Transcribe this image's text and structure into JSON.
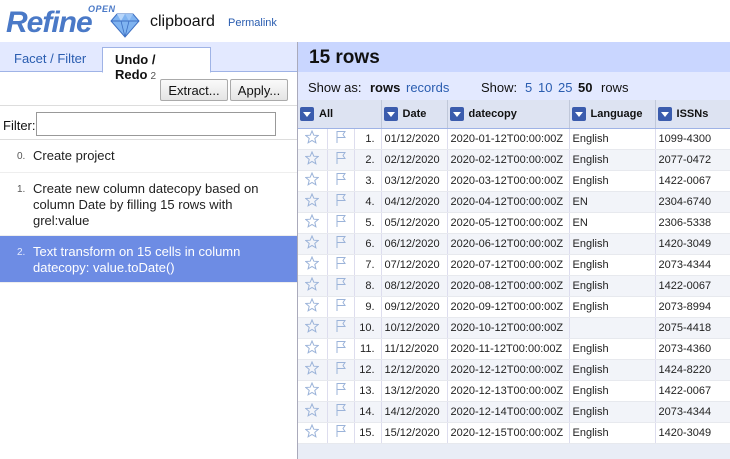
{
  "header": {
    "logo_open": "OPEN",
    "logo_refine": "Refine",
    "project_title": "clipboard",
    "permalink": "Permalink"
  },
  "left": {
    "tabs": [
      {
        "label": "Facet / Filter"
      },
      {
        "label": "Undo / Redo",
        "count": "2"
      }
    ],
    "extract_label": "Extract...",
    "apply_label": "Apply...",
    "filter_label": "Filter:",
    "filter_value": "",
    "history": [
      {
        "index": "0.",
        "text": "Create project"
      },
      {
        "index": "1.",
        "text": "Create new column datecopy based on column Date by filling 15 rows with grel:value"
      },
      {
        "index": "2.",
        "text": "Text transform on 15 cells in column datecopy: value.toDate()"
      }
    ]
  },
  "right": {
    "rows_title": "15 rows",
    "show_as_label": "Show as:",
    "rows_mode": "rows",
    "records_mode": "records",
    "show_label": "Show:",
    "page_sizes": [
      "5",
      "10",
      "25",
      "50"
    ],
    "rows_word": "rows",
    "columns": [
      "All",
      "Date",
      "datecopy",
      "Language",
      "ISSNs"
    ],
    "rows": [
      {
        "num": "1.",
        "date": "01/12/2020",
        "datecopy": "2020-01-12T00:00:00Z",
        "language": "English",
        "issns": "1099-4300"
      },
      {
        "num": "2.",
        "date": "02/12/2020",
        "datecopy": "2020-02-12T00:00:00Z",
        "language": "English",
        "issns": "2077-0472"
      },
      {
        "num": "3.",
        "date": "03/12/2020",
        "datecopy": "2020-03-12T00:00:00Z",
        "language": "English",
        "issns": "1422-0067"
      },
      {
        "num": "4.",
        "date": "04/12/2020",
        "datecopy": "2020-04-12T00:00:00Z",
        "language": "EN",
        "issns": "2304-6740"
      },
      {
        "num": "5.",
        "date": "05/12/2020",
        "datecopy": "2020-05-12T00:00:00Z",
        "language": "EN",
        "issns": "2306-5338"
      },
      {
        "num": "6.",
        "date": "06/12/2020",
        "datecopy": "2020-06-12T00:00:00Z",
        "language": "English",
        "issns": "1420-3049"
      },
      {
        "num": "7.",
        "date": "07/12/2020",
        "datecopy": "2020-07-12T00:00:00Z",
        "language": "English",
        "issns": "2073-4344"
      },
      {
        "num": "8.",
        "date": "08/12/2020",
        "datecopy": "2020-08-12T00:00:00Z",
        "language": "English",
        "issns": "1422-0067"
      },
      {
        "num": "9.",
        "date": "09/12/2020",
        "datecopy": "2020-09-12T00:00:00Z",
        "language": "English",
        "issns": "2073-8994"
      },
      {
        "num": "10.",
        "date": "10/12/2020",
        "datecopy": "2020-10-12T00:00:00Z",
        "language": "",
        "issns": "2075-4418"
      },
      {
        "num": "11.",
        "date": "11/12/2020",
        "datecopy": "2020-11-12T00:00:00Z",
        "language": "English",
        "issns": "2073-4360"
      },
      {
        "num": "12.",
        "date": "12/12/2020",
        "datecopy": "2020-12-12T00:00:00Z",
        "language": "English",
        "issns": "1424-8220"
      },
      {
        "num": "13.",
        "date": "13/12/2020",
        "datecopy": "2020-12-13T00:00:00Z",
        "language": "English",
        "issns": "1422-0067"
      },
      {
        "num": "14.",
        "date": "14/12/2020",
        "datecopy": "2020-12-14T00:00:00Z",
        "language": "English",
        "issns": "2073-4344"
      },
      {
        "num": "15.",
        "date": "15/12/2020",
        "datecopy": "2020-12-15T00:00:00Z",
        "language": "English",
        "issns": "1420-3049"
      }
    ]
  },
  "colors": {
    "brand": "#4a79c7",
    "selected_history": "#6d8ce4",
    "rows_header_bg": "#c9d6ff",
    "datecopy_text": "#2e8b2e"
  }
}
